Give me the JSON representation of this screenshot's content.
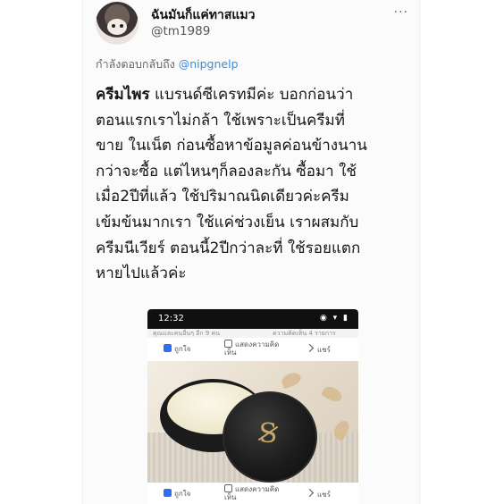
{
  "header": {
    "display_name": "ฉันมันก็แค่ทาสแมว",
    "handle": "@tm1989",
    "more_icon": "ellipsis-icon",
    "more_glyph": "···"
  },
  "reply": {
    "prefix": "กำลังตอบกลับถึง ",
    "mention": "@nipgnelp"
  },
  "tweet": {
    "lead": "ครีมไพร",
    "lines": [
      " แบรนด์ซีเครทมีค่ะ บอกก่อนว่า",
      "ตอนแรกเราไม่กล้า ใช้เพราะเป็นครีมที่",
      "ขาย ในเน็ต ก่อนซื้อหาข้อมูลค่อนข้างนาน",
      "กว่าจะซื้อ แต่ไหนๆก็ลองละกัน ซื้อมา ใช้",
      "เมื่อ2ปีที่แล้ว ใช้ปริมาณนิดเดียวค่ะครีม",
      "เข้มข้นมากเรา ใช้แค่ช่วงเย็น เราผสมกับ",
      "ครีมนีเวียร์ ตอนนี้2ปีกว่าละที่ ใช้รอยแตก",
      "หายไปแล้วค่ะ"
    ]
  },
  "screenshot": {
    "time": "12:32",
    "status_icons": "◉ ▾ ▮",
    "crumb_left": "คุณและคนอื่นๆ อีก 9 คน",
    "crumb_right": "ความคิดเห็น 4 รายการ",
    "actions_top": {
      "like": "ถูกใจ",
      "comment": "แสดงความคิด เห็น",
      "share": "แชร์"
    },
    "actions_bottom": {
      "like": "ถูกใจ",
      "comment": "แสดงความคิด เห็น",
      "share": "แชร์"
    },
    "logo_glyph": "S"
  }
}
